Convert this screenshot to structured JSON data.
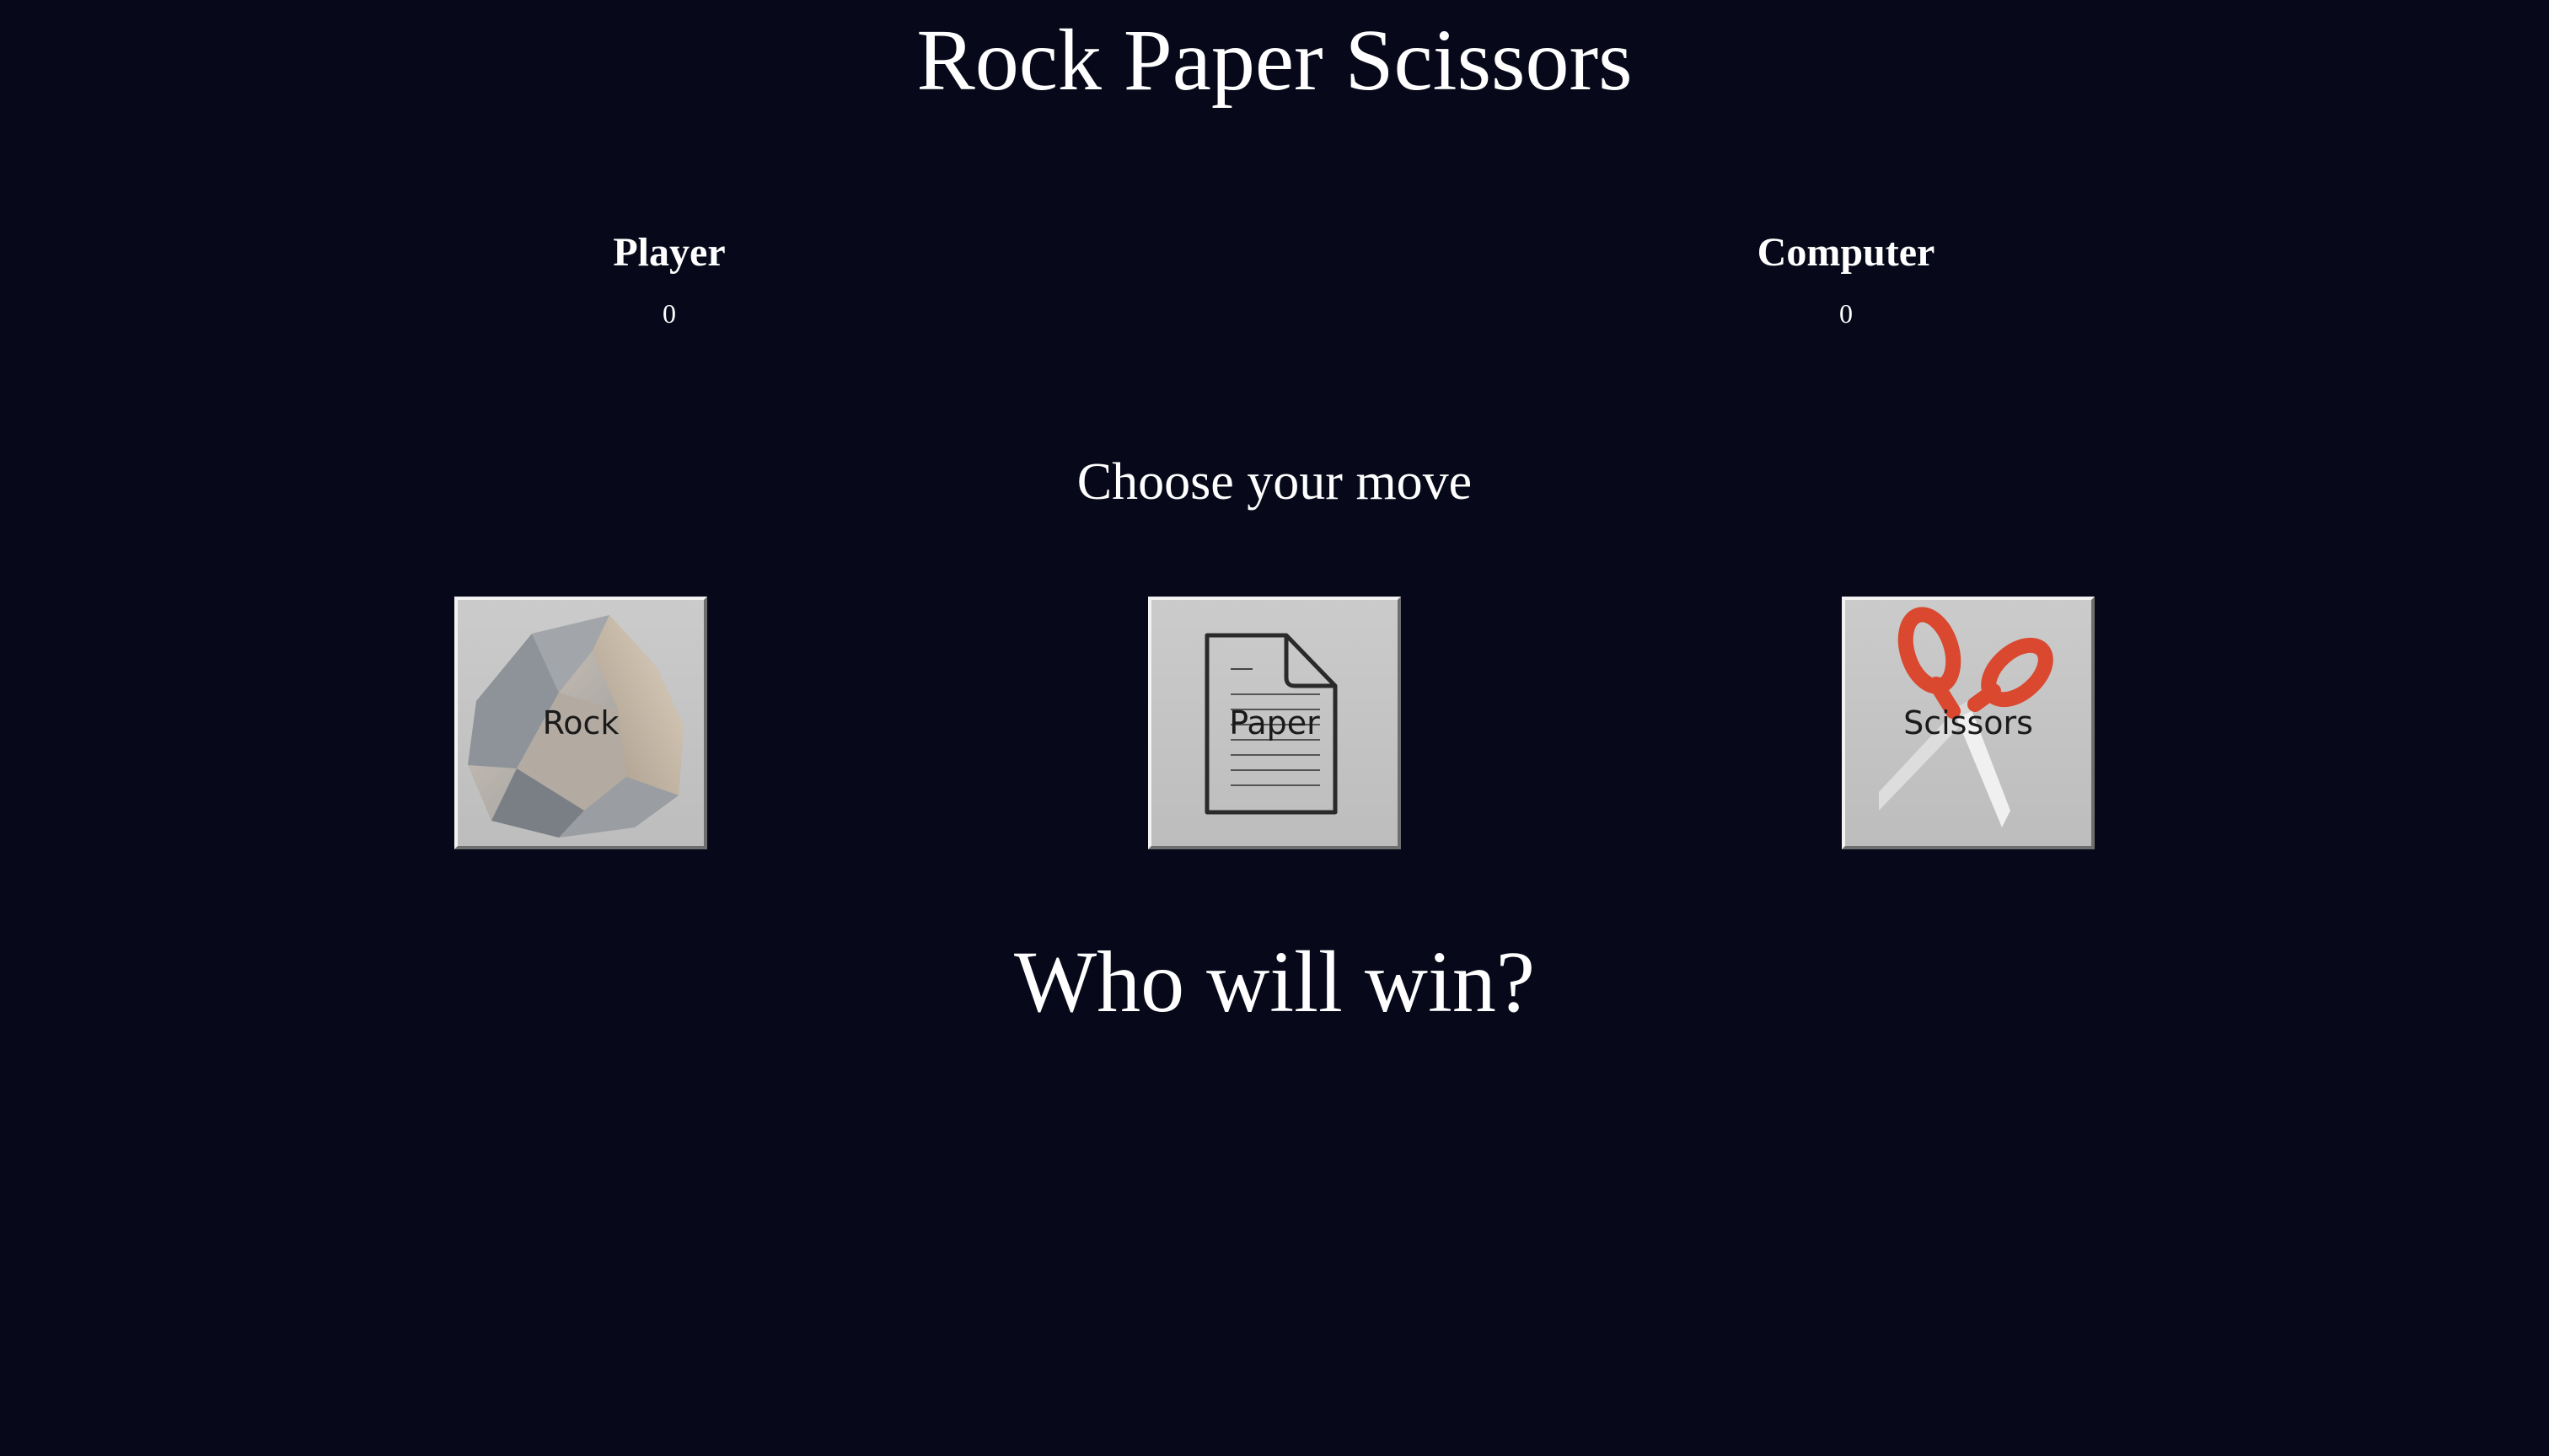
{
  "header": {
    "title": "Rock Paper Scissors"
  },
  "scoreboard": {
    "player": {
      "label": "Player",
      "score": "0"
    },
    "computer": {
      "label": "Computer",
      "score": "0"
    }
  },
  "moves": {
    "prompt": "Choose your move",
    "options": [
      {
        "label": "Rock",
        "icon": "rock-icon"
      },
      {
        "label": "Paper",
        "icon": "paper-icon"
      },
      {
        "label": "Scissors",
        "icon": "scissors-icon"
      }
    ]
  },
  "result": {
    "text": "Who will win?"
  },
  "colors": {
    "background": "#07091a",
    "text": "#ffffff",
    "button_face": "#c4c4c4",
    "scissors_handle": "#d9482f"
  }
}
